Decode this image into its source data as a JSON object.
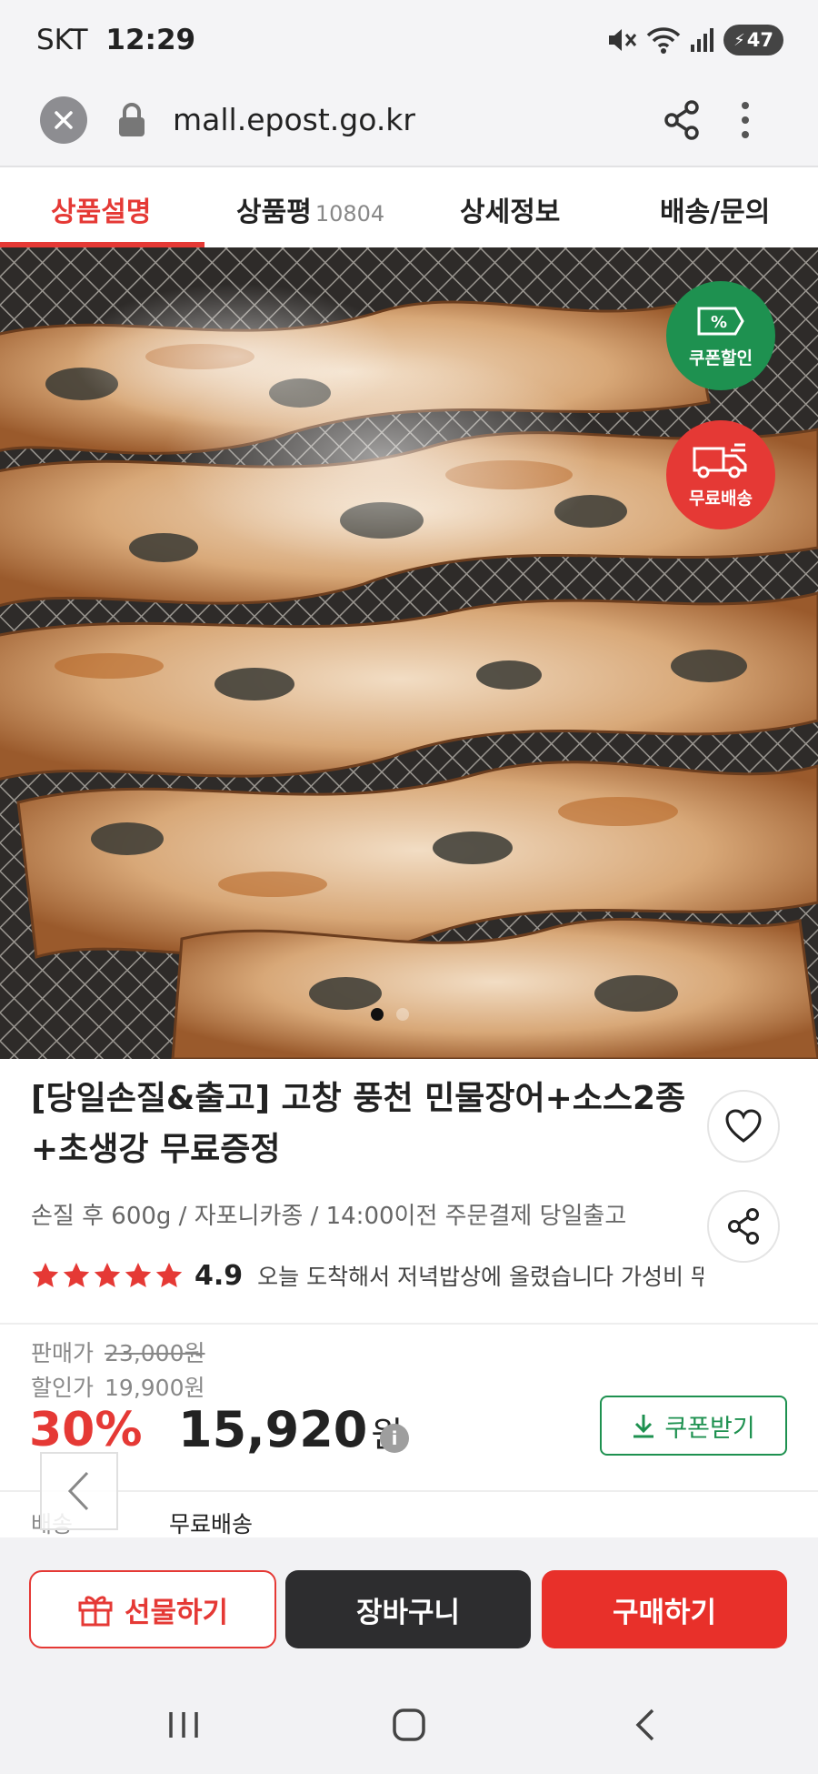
{
  "status_bar": {
    "carrier": "SKT",
    "time": "12:29",
    "battery": "47"
  },
  "browser": {
    "url": "mall.epost.go.kr"
  },
  "tabs": [
    {
      "label": "상품설명",
      "active": true
    },
    {
      "label": "상품평",
      "count": "10804",
      "active": false
    },
    {
      "label": "상세정보",
      "active": false
    },
    {
      "label": "배송/문의",
      "active": false
    }
  ],
  "hero": {
    "badges": {
      "coupon": "쿠폰할인",
      "delivery": "무료배송"
    },
    "coupon_symbol": "%",
    "pager": {
      "total": 2,
      "current": 1
    }
  },
  "product": {
    "title": "[당일손질&출고] 고창 풍천 민물장어+소스2종+초생강 무료증정",
    "subtitle": "손질 후 600g / 자포니카종 / 14:00이전 주문결제 당일출고",
    "rating": "4.9",
    "stars": 5,
    "review_snippet": "오늘 도착해서 저녁밥상에 올렸습니다 가성비 뚜"
  },
  "price": {
    "list_label": "판매가",
    "list_price": "23,000원",
    "sale_label": "할인가",
    "sale_price": "19,900원",
    "discount_rate": "30%",
    "final_price": "15,920",
    "final_unit": "원",
    "info_symbol": "i",
    "coupon_button": "쿠폰받기"
  },
  "shipping": {
    "label": "배송",
    "value": "무료배송"
  },
  "actions": {
    "gift": "선물하기",
    "cart": "장바구니",
    "buy": "구매하기"
  },
  "colors": {
    "accent_red": "#e53935",
    "coupon_green": "#1e9150",
    "cart_dark": "#2d2d2f"
  },
  "icons": [
    "mute-icon",
    "wifi-icon",
    "signal-icon",
    "battery-icon",
    "close-icon",
    "lock-icon",
    "share-icon",
    "more-icon",
    "heart-icon",
    "chevron-left-icon",
    "download-icon",
    "gift-icon",
    "recents-icon",
    "home-icon",
    "back-icon"
  ]
}
